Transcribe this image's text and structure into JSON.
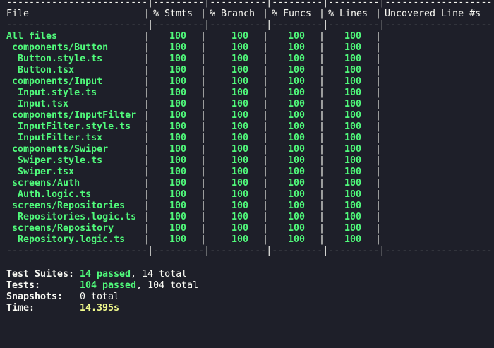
{
  "headers": {
    "file": "File",
    "stmts": "% Stmts",
    "branch": "% Branch",
    "funcs": "% Funcs",
    "lines": "% Lines",
    "uncovered": "Uncovered Line #s"
  },
  "rows": [
    {
      "name": "All files",
      "stmts": "100",
      "branch": "100",
      "funcs": "100",
      "lines": "100"
    },
    {
      "name": " components/Button",
      "stmts": "100",
      "branch": "100",
      "funcs": "100",
      "lines": "100"
    },
    {
      "name": "  Button.style.ts",
      "stmts": "100",
      "branch": "100",
      "funcs": "100",
      "lines": "100"
    },
    {
      "name": "  Button.tsx",
      "stmts": "100",
      "branch": "100",
      "funcs": "100",
      "lines": "100"
    },
    {
      "name": " components/Input",
      "stmts": "100",
      "branch": "100",
      "funcs": "100",
      "lines": "100"
    },
    {
      "name": "  Input.style.ts",
      "stmts": "100",
      "branch": "100",
      "funcs": "100",
      "lines": "100"
    },
    {
      "name": "  Input.tsx",
      "stmts": "100",
      "branch": "100",
      "funcs": "100",
      "lines": "100"
    },
    {
      "name": " components/InputFilter",
      "stmts": "100",
      "branch": "100",
      "funcs": "100",
      "lines": "100"
    },
    {
      "name": "  InputFilter.style.ts",
      "stmts": "100",
      "branch": "100",
      "funcs": "100",
      "lines": "100"
    },
    {
      "name": "  InputFilter.tsx",
      "stmts": "100",
      "branch": "100",
      "funcs": "100",
      "lines": "100"
    },
    {
      "name": " components/Swiper",
      "stmts": "100",
      "branch": "100",
      "funcs": "100",
      "lines": "100"
    },
    {
      "name": "  Swiper.style.ts",
      "stmts": "100",
      "branch": "100",
      "funcs": "100",
      "lines": "100"
    },
    {
      "name": "  Swiper.tsx",
      "stmts": "100",
      "branch": "100",
      "funcs": "100",
      "lines": "100"
    },
    {
      "name": " screens/Auth",
      "stmts": "100",
      "branch": "100",
      "funcs": "100",
      "lines": "100"
    },
    {
      "name": "  Auth.logic.ts",
      "stmts": "100",
      "branch": "100",
      "funcs": "100",
      "lines": "100"
    },
    {
      "name": " screens/Repositories",
      "stmts": "100",
      "branch": "100",
      "funcs": "100",
      "lines": "100"
    },
    {
      "name": "  Repositories.logic.ts",
      "stmts": "100",
      "branch": "100",
      "funcs": "100",
      "lines": "100"
    },
    {
      "name": " screens/Repository",
      "stmts": "100",
      "branch": "100",
      "funcs": "100",
      "lines": "100"
    },
    {
      "name": "  Repository.logic.ts",
      "stmts": "100",
      "branch": "100",
      "funcs": "100",
      "lines": "100"
    }
  ],
  "summary": {
    "suites_label": "Test Suites:",
    "suites_passed": "14 passed",
    "suites_total": ", 14 total",
    "tests_label": "Tests:",
    "tests_passed": "104 passed",
    "tests_total": ", 104 total",
    "snapshots_label": "Snapshots:",
    "snapshots_value": "0 total",
    "time_label": "Time:",
    "time_value": "14.395s"
  },
  "colors": {
    "background": "#1e1f29",
    "text": "#f8f8f2",
    "pass": "#50fa7b",
    "time": "#f1fa8c"
  }
}
